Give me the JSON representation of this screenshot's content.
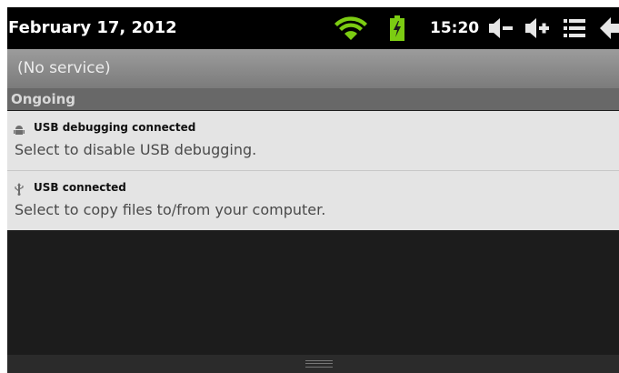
{
  "status_bar": {
    "date": "February 17, 2012",
    "time": "15:20",
    "icons": [
      "wifi-icon",
      "battery-charging-icon",
      "volume-down-icon",
      "volume-up-icon",
      "menu-icon",
      "back-icon"
    ],
    "colors": {
      "wifi": "#7ccc12",
      "battery": "#7ccc12"
    }
  },
  "carrier": {
    "label": "(No service)"
  },
  "section": {
    "label": "Ongoing"
  },
  "notifications": [
    {
      "icon": "android-icon",
      "title": "USB debugging connected",
      "subtitle": "Select to disable USB debugging."
    },
    {
      "icon": "usb-icon",
      "title": "USB connected",
      "subtitle": "Select to copy files to/from your computer."
    }
  ]
}
